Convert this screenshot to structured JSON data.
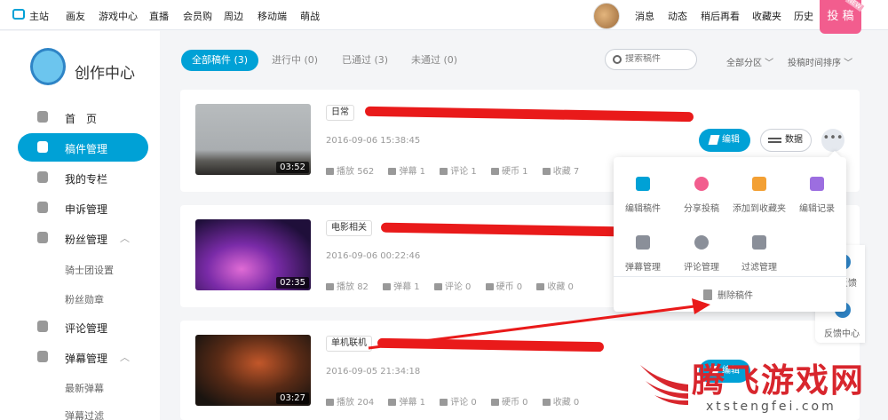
{
  "topbar": {
    "home": "主站",
    "nav": [
      "画友",
      "游戏中心",
      "直播",
      "会员购",
      "周边",
      "移动端",
      "萌战"
    ],
    "right": [
      "消息",
      "动态",
      "稍后再看",
      "收藏夹",
      "历史"
    ],
    "upload": "投 稿",
    "upload_badge": "NEW"
  },
  "sidebar": {
    "logo_text": "创作中心",
    "items": [
      {
        "label": "首　页",
        "icon": "home-icon"
      },
      {
        "label": "稿件管理",
        "icon": "manuscript-icon",
        "active": true
      },
      {
        "label": "我的专栏",
        "icon": "article-icon"
      },
      {
        "label": "申诉管理",
        "icon": "shield-icon"
      },
      {
        "label": "粉丝管理",
        "icon": "fans-icon",
        "expanded": true
      },
      {
        "label": "骑士团设置",
        "sub": true
      },
      {
        "label": "粉丝勋章",
        "sub": true
      },
      {
        "label": "评论管理",
        "icon": "comment-icon"
      },
      {
        "label": "弹幕管理",
        "icon": "danmaku-icon",
        "expanded": true
      },
      {
        "label": "最新弹幕",
        "sub": true
      },
      {
        "label": "弹幕过滤",
        "sub": true
      }
    ]
  },
  "main": {
    "tabs": [
      {
        "label": "全部稿件 (3)",
        "active": true
      },
      {
        "label": "进行中 (0)"
      },
      {
        "label": "已通过 (3)"
      },
      {
        "label": "未通过 (0)"
      }
    ],
    "search_placeholder": "搜索稿件",
    "zone_filter": "全部分区",
    "sort_filter": "投稿时间排序",
    "stat_labels": [
      "播放",
      "弹幕",
      "评论",
      "硬币",
      "收藏"
    ],
    "edit_label": "编辑",
    "data_label": "数据",
    "videos": [
      {
        "zone": "日常",
        "date": "2016-09-06 15:38:45",
        "duration": "03:52",
        "stats": [
          "562",
          "1",
          "1",
          "1",
          "7"
        ]
      },
      {
        "zone": "电影相关",
        "date": "2016-09-06 00:22:46",
        "duration": "02:35",
        "stats": [
          "82",
          "1",
          "0",
          "0",
          "0"
        ]
      },
      {
        "zone": "单机联机",
        "date": "2016-09-05 21:34:18",
        "duration": "03:27",
        "stats": [
          "204",
          "1",
          "0",
          "0",
          "0"
        ]
      }
    ]
  },
  "popover": {
    "row1": [
      "编辑稿件",
      "分享投稿",
      "添加到收藏夹",
      "编辑记录"
    ],
    "row2": [
      "弹幕管理",
      "评论管理",
      "过滤管理"
    ],
    "delete": "删除稿件"
  },
  "feedback": {
    "label1": "反馈",
    "label2": "反馈中心"
  },
  "watermark": {
    "text": "腾飞游戏网",
    "url": "xtstengfei.com"
  },
  "colors": {
    "accent": "#00a1d6",
    "upload": "#f25d8e",
    "redaction": "#e91a1a",
    "watermark": "#d8262d"
  }
}
